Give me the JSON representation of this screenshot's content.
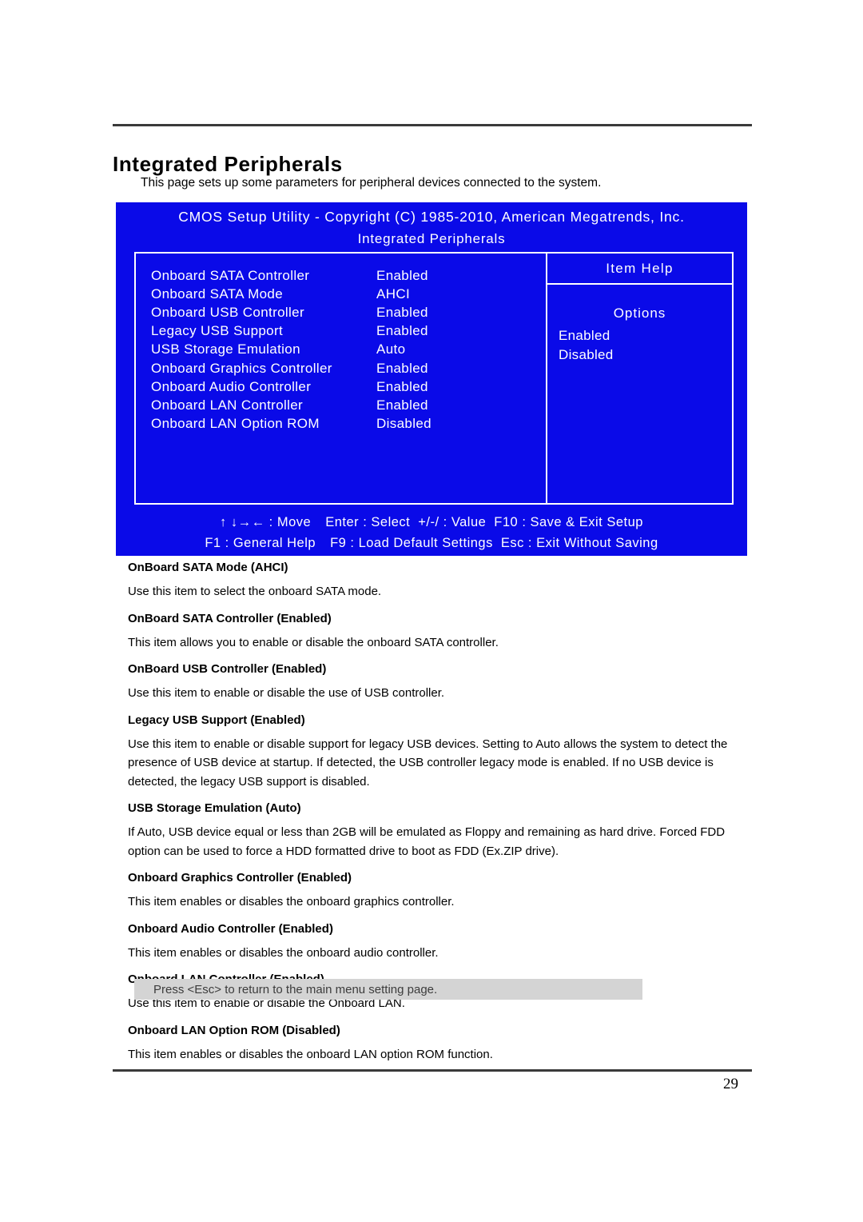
{
  "document": {
    "title": "Integrated Peripherals",
    "intro": "This page sets up some parameters for peripheral devices connected to the system.",
    "page_number": "29",
    "note": "Press <Esc> to return to the main menu setting page."
  },
  "bios": {
    "header": "CMOS Setup Utility - Copyright (C) 1985-2010, American Megatrends, Inc.",
    "screen_title": "Integrated Peripherals",
    "background_color": "#0a0ae8",
    "text_color": "#ffffff",
    "settings": [
      {
        "label": "Onboard SATA Controller",
        "value": "Enabled"
      },
      {
        "label": "Onboard SATA Mode",
        "value": "AHCI"
      },
      {
        "label": "Onboard USB Controller",
        "value": "Enabled"
      },
      {
        "label": "Legacy USB Support",
        "value": "Enabled"
      },
      {
        "label": "USB Storage Emulation",
        "value": "Auto"
      },
      {
        "label": "Onboard Graphics Controller",
        "value": "Enabled"
      },
      {
        "label": "Onboard Audio Controller",
        "value": "Enabled"
      },
      {
        "label": "Onboard LAN Controller",
        "value": "Enabled"
      },
      {
        "label": "Onboard LAN Option ROM",
        "value": "Disabled"
      }
    ],
    "item_help": {
      "heading": "Item Help",
      "options_title": "Options",
      "options": [
        "Enabled",
        "Disabled"
      ]
    },
    "keys": {
      "move_keys": "↑ ↓→← : Move",
      "enter": "Enter : Select",
      "value": "+/-/ : Value",
      "f10": "F10 : Save & Exit Setup",
      "f1": "F1 : General Help",
      "f9": "F9 : Load Default Settings",
      "esc": "Esc :  Exit Without Saving"
    }
  },
  "descriptions": [
    {
      "heading": "OnBoard SATA Mode (AHCI)",
      "body": "Use this item to select the onboard SATA mode."
    },
    {
      "heading": "OnBoard SATA Controller (Enabled)",
      "body": "This item allows you to enable or disable the onboard SATA controller."
    },
    {
      "heading": "OnBoard USB Controller (Enabled)",
      "body": "Use this item to enable or disable the use of USB controller."
    },
    {
      "heading": "Legacy USB Support (Enabled)",
      "body": "Use this item to enable or disable support for legacy USB devices. Setting to Auto allows the system to detect the presence of USB device at startup. If detected, the USB controller legacy mode is enabled. If no USB device is detected, the legacy USB support is disabled."
    },
    {
      "heading": "USB Storage Emulation (Auto)",
      "body": "If Auto, USB device equal or less than 2GB will be emulated as Floppy and remaining as hard drive. Forced FDD option can be used to force a HDD formatted drive to boot as FDD (Ex.ZIP drive)."
    },
    {
      "heading": "Onboard Graphics Controller (Enabled)",
      "body": "This item enables or disables the onboard graphics controller."
    },
    {
      "heading": "Onboard Audio Controller (Enabled)",
      "body": "This item enables or disables the onboard audio controller."
    },
    {
      "heading": "Onboard LAN Controller (Enabled)",
      "body": "Use this item to enable or disable the Onboard LAN."
    },
    {
      "heading": "Onboard LAN Option ROM (Disabled)",
      "body": "This item enables or disables the onboard LAN option ROM function."
    }
  ]
}
